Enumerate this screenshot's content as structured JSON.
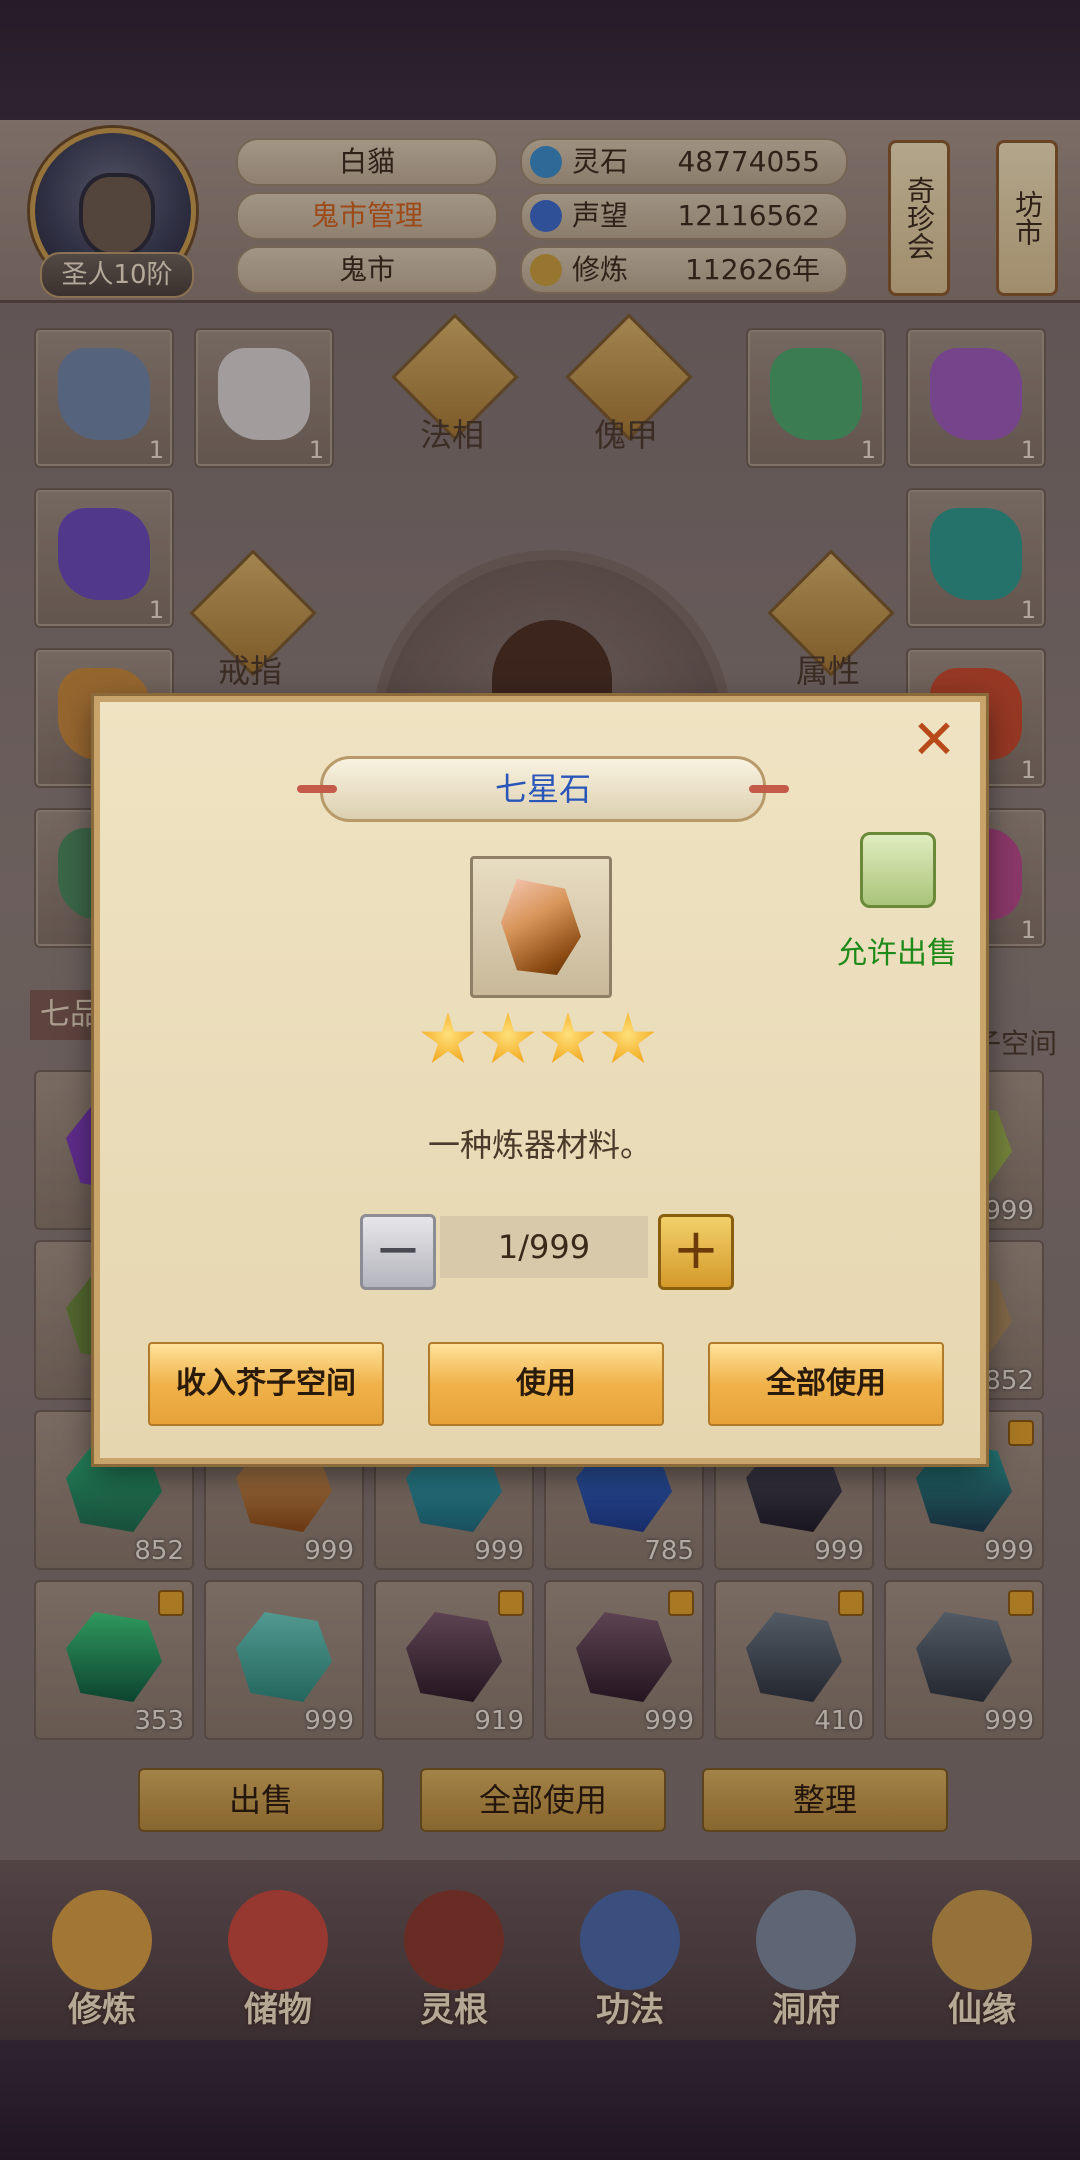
{
  "player": {
    "rank": "圣人10阶",
    "name": "白貓",
    "role": "鬼市管理",
    "location": "鬼市"
  },
  "resources": [
    {
      "label": "灵石",
      "value": "48774055",
      "icon": "spirit-stone-icon",
      "color": "#3a8ec9"
    },
    {
      "label": "声望",
      "value": "12116562",
      "icon": "prestige-icon",
      "color": "#3a6ac9"
    },
    {
      "label": "修炼",
      "value": "112626年",
      "icon": "meditation-icon",
      "color": "#c9a03a"
    }
  ],
  "side_buttons": {
    "treasure": "奇珍会",
    "market": "坊市"
  },
  "equip_tabs": {
    "fa_xiang": "法相",
    "kui_jia": "傀甲",
    "ring": "戒指",
    "attributes": "属性"
  },
  "equip_counts": [
    "1",
    "1",
    "1",
    "1",
    "1",
    "1",
    "1",
    "1",
    "1"
  ],
  "section_tab": "七品",
  "mustard_space_hint": "子空间",
  "inventory_counts_visible": [
    "852",
    "999",
    "999",
    "785",
    "999",
    "999",
    "353",
    "999",
    "919",
    "999",
    "410",
    "999",
    "999",
    "852"
  ],
  "bottom_actions": {
    "sell": "出售",
    "use_all": "全部使用",
    "arrange": "整理"
  },
  "nav": [
    {
      "label": "修炼",
      "icon": "cultivation-icon"
    },
    {
      "label": "储物",
      "icon": "storage-bag-icon"
    },
    {
      "label": "灵根",
      "icon": "spirit-root-icon"
    },
    {
      "label": "功法",
      "icon": "technique-book-icon"
    },
    {
      "label": "洞府",
      "icon": "cave-dwelling-icon"
    },
    {
      "label": "仙缘",
      "icon": "immortal-fate-icon"
    }
  ],
  "modal": {
    "title": "七星石",
    "allow_sell": "允许出售",
    "stars": 4,
    "description": "一种炼器材料。",
    "quantity": "1/999",
    "buttons": {
      "store": "收入芥子空间",
      "use": "使用",
      "use_all": "全部使用"
    },
    "colors": {
      "title": "#2a56b8",
      "allow": "#1f8a1a",
      "close": "#b84a1a"
    }
  }
}
